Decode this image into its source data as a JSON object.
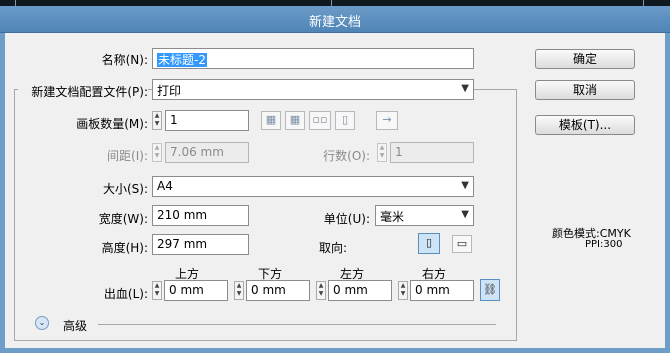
{
  "dialog": {
    "title": "新建文档"
  },
  "name": {
    "label": "名称(N):",
    "value": "未标题-2"
  },
  "profile": {
    "label": "新建文档配置文件(P):",
    "value": "打印"
  },
  "artboards": {
    "label": "画板数量(M):",
    "value": "1"
  },
  "spacing": {
    "label": "间距(I):",
    "value": "7.06 mm"
  },
  "rows": {
    "label": "行数(O):",
    "value": "1"
  },
  "size": {
    "label": "大小(S):",
    "value": "A4"
  },
  "width": {
    "label": "宽度(W):",
    "value": "210 mm"
  },
  "units": {
    "label": "单位(U):",
    "value": "毫米"
  },
  "height": {
    "label": "高度(H):",
    "value": "297 mm"
  },
  "orientation": {
    "label": "取向:"
  },
  "bleed": {
    "label": "出血(L):",
    "top_label": "上方",
    "bottom_label": "下方",
    "left_label": "左方",
    "right_label": "右方",
    "top": "0 mm",
    "bottom": "0 mm",
    "left": "0 mm",
    "right": "0 mm"
  },
  "advanced": {
    "label": "高级"
  },
  "buttons": {
    "ok": "确定",
    "cancel": "取消",
    "templates": "模板(T)..."
  },
  "info": {
    "color_mode": "颜色模式:CMYK",
    "ppi": "PPI:300"
  },
  "colors": {
    "title_bar": "#5a8fc0",
    "frame": "#6e9ec8",
    "selection": "#3399ff"
  }
}
